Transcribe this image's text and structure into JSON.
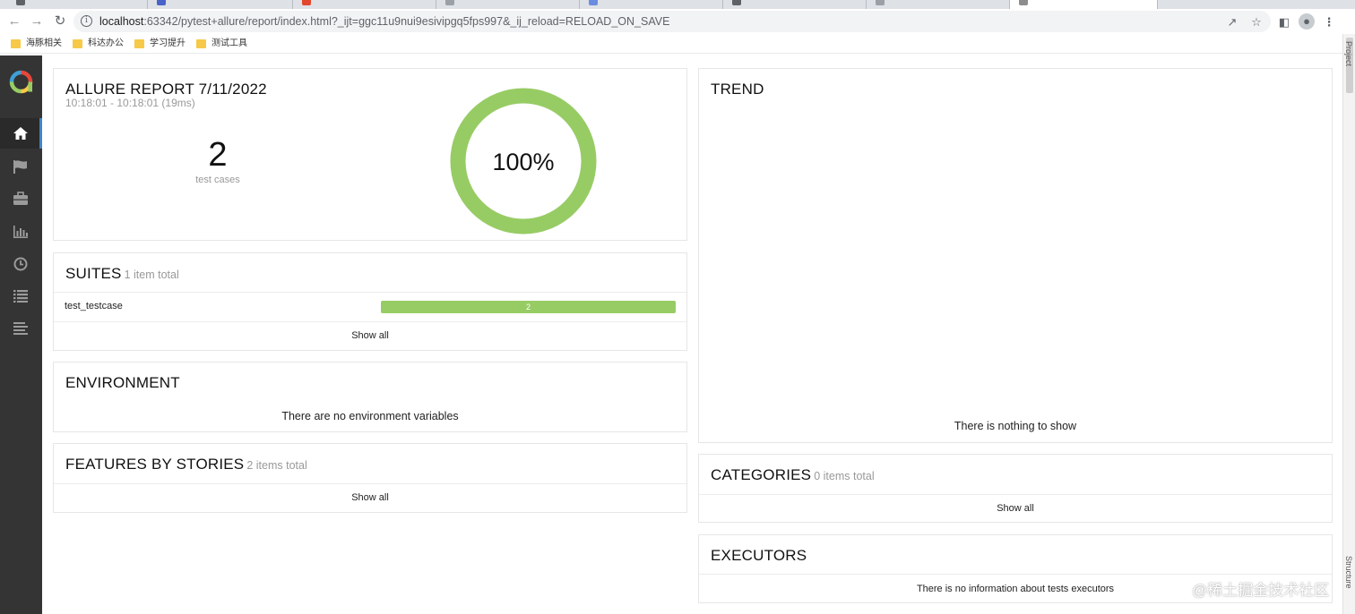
{
  "browser": {
    "url_host": "localhost",
    "url_rest": ":63342/pytest+allure/report/index.html?_ijt=ggc11u9nui9esivipgq5fps997&_ij_reload=RELOAD_ON_SAVE",
    "bookmarks": [
      "海豚相关",
      "科达办公",
      "学习提升",
      "测试工具"
    ]
  },
  "sidebar": {
    "items": [
      {
        "icon": "home-icon"
      },
      {
        "icon": "flag-icon"
      },
      {
        "icon": "briefcase-icon"
      },
      {
        "icon": "bar-chart-icon"
      },
      {
        "icon": "clock-icon"
      },
      {
        "icon": "list-icon"
      },
      {
        "icon": "align-left-icon"
      }
    ]
  },
  "summary": {
    "title": "ALLURE REPORT 7/11/2022",
    "time_range": "10:18:01 - 10:18:01 (19ms)",
    "test_count": "2",
    "test_count_label": "test cases",
    "pass_rate_text": "100%",
    "pass_rate": 1.0
  },
  "suites": {
    "title": "SUITES",
    "subtitle": "1 item total",
    "rows": [
      {
        "name": "test_testcase",
        "passed": "2",
        "fraction": 1.0
      }
    ],
    "show_all": "Show all"
  },
  "environment": {
    "title": "ENVIRONMENT",
    "empty_text": "There are no environment variables"
  },
  "features": {
    "title": "FEATURES BY STORIES",
    "subtitle": "2 items total",
    "show_all": "Show all"
  },
  "trend": {
    "title": "TREND",
    "empty_text": "There is nothing to show"
  },
  "categories": {
    "title": "CATEGORIES",
    "subtitle": "0 items total",
    "show_all": "Show all"
  },
  "executors": {
    "title": "EXECUTORS",
    "empty_text": "There is no information about tests executors"
  },
  "ide_panel": {
    "top_label": "Project",
    "bottom_label": "Structure"
  },
  "watermark": "@稀土掘金技术社区",
  "colors": {
    "passed": "#97cc64",
    "sidebar": "#343434",
    "active_marker": "#3f86c7"
  }
}
